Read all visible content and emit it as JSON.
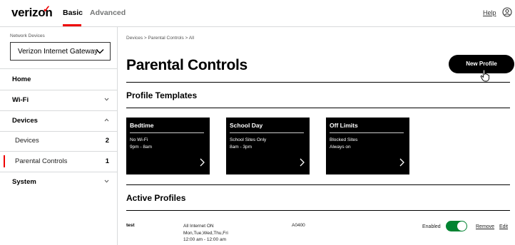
{
  "header": {
    "logo": "verizon",
    "tabs": [
      "Basic",
      "Advanced"
    ],
    "help": "Help",
    "user_icon": "user-circle-icon"
  },
  "sidebar": {
    "network_devices_label": "Network Devices",
    "device_select_value": "Verizon Internet Gateway",
    "items": [
      {
        "label": "Home"
      },
      {
        "label": "Wi-Fi"
      },
      {
        "label": "Devices"
      },
      {
        "label": "Devices",
        "count": "2"
      },
      {
        "label": "Parental Controls",
        "count": "1"
      },
      {
        "label": "System"
      }
    ]
  },
  "main": {
    "breadcrumb": "Devices  >  Parental Controls  >  All",
    "title": "Parental Controls",
    "new_profile_label": "New Profile",
    "templates_title": "Profile Templates",
    "templates": [
      {
        "title": "Bedtime",
        "line1": "No Wi-Fi",
        "line2": "9pm - 8am"
      },
      {
        "title": "School Day",
        "line1": "School Sites Only",
        "line2": "8am - 3pm"
      },
      {
        "title": "Off Limits",
        "line1": "Blocked Sites",
        "line2": "Always on"
      }
    ],
    "active_title": "Active Profiles",
    "active_profiles": [
      {
        "name": "test",
        "line1": "All Internet ON",
        "line2": "Mon,Tue,Wed,Thu,Fri",
        "line3": "12:00 am - 12:00 am",
        "code": "A0400",
        "status": "Enabled",
        "remove": "Remove",
        "edit": "Edit"
      }
    ]
  },
  "colors": {
    "accent_red": "#ee0000",
    "toggle_green": "#008331"
  }
}
